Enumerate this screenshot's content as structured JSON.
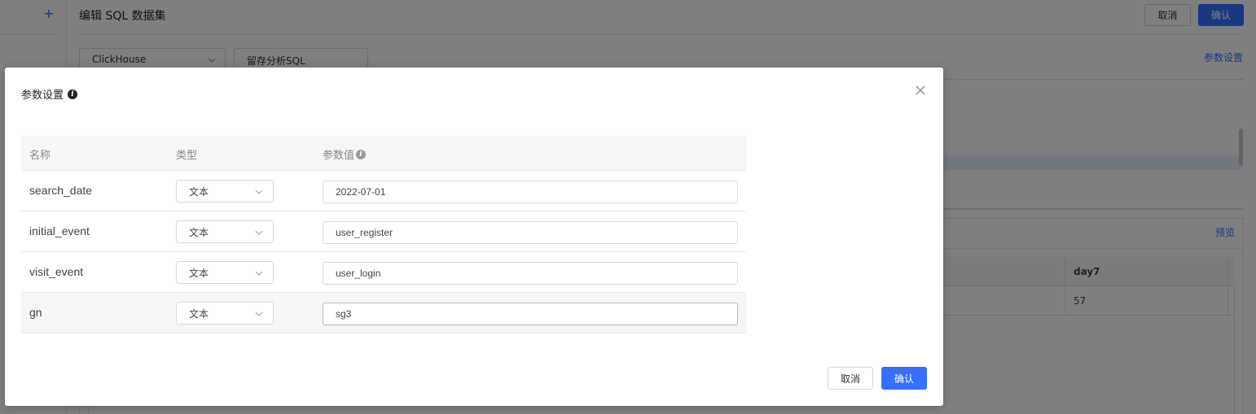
{
  "background": {
    "title": "编辑 SQL 数据集",
    "cancel_label": "取消",
    "confirm_label": "确认",
    "datasource_value": "ClickHouse",
    "sql_name_value": "留存分析SQL",
    "params_link": "参数设置",
    "preview_link": "预览",
    "preview_table": {
      "header": "day7",
      "value": "57"
    },
    "add_icon": "plus-icon"
  },
  "modal": {
    "title": "参数设置",
    "columns": {
      "name": "名称",
      "type": "类型",
      "value": "参数值"
    },
    "rows": [
      {
        "name": "search_date",
        "type": "文本",
        "value": "2022-07-01"
      },
      {
        "name": "initial_event",
        "type": "文本",
        "value": "user_register"
      },
      {
        "name": "visit_event",
        "type": "文本",
        "value": "user_login"
      },
      {
        "name": "gn",
        "type": "文本",
        "value": "sg3"
      }
    ],
    "cancel_label": "取消",
    "confirm_label": "确认"
  },
  "colors": {
    "primary": "#3370ff",
    "mask": "rgba(0,0,0,0.5)",
    "table_header_bg": "#f5f6f8"
  }
}
